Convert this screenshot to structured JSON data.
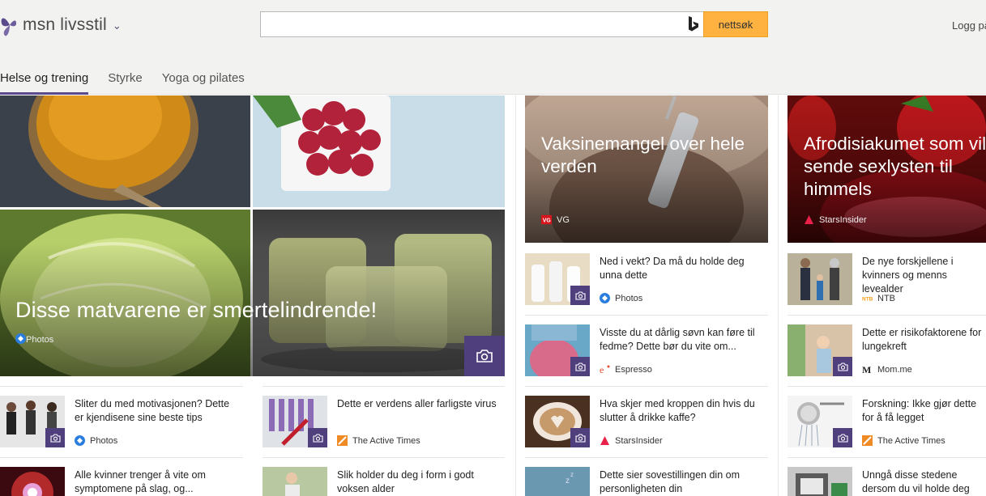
{
  "header": {
    "brand": "msn livsstil",
    "search_placeholder": "",
    "search_button": "nettsøk",
    "login": "Logg på"
  },
  "tabs": [
    {
      "label": "Helse og trening",
      "active": true
    },
    {
      "label": "Styrke",
      "active": false
    },
    {
      "label": "Yoga og pilates",
      "active": false
    }
  ],
  "hero": {
    "title": "Disse matvarene er smertelindrende!",
    "source": "Photos"
  },
  "big_cards": [
    {
      "title": "Vaksinemangel over hele verden",
      "source": "VG"
    },
    {
      "title": "Afrodisiakumet som vil sende sexlysten til himmels",
      "source": "StarsInsider"
    }
  ],
  "col1_items": [
    {
      "title": "Sliter du med motivasjonen? Dette er kjendisene sine beste tips",
      "source": "Photos"
    },
    {
      "title": "Alle kvinner trenger å vite om symptomene på slag, og...",
      "source": ""
    }
  ],
  "col2_items": [
    {
      "title": "Dette er verdens aller farligste virus",
      "source": "The Active Times"
    },
    {
      "title": "Slik holder du deg i form i godt voksen alder",
      "source": ""
    }
  ],
  "col3_items": [
    {
      "title": "Ned i vekt? Da må du holde deg unna dette",
      "source": "Photos"
    },
    {
      "title": "Visste du at dårlig søvn kan føre til fedme? Dette bør du vite om...",
      "source": "Espresso"
    },
    {
      "title": "Hva skjer med kroppen din hvis du slutter å drikke kaffe?",
      "source": "StarsInsider"
    },
    {
      "title": "Dette sier sovestillingen din om personligheten din",
      "source": ""
    }
  ],
  "col4_items": [
    {
      "title": "De nye forskjellene i kvinners og menns levealder",
      "source": "NTB"
    },
    {
      "title": "Dette er risikofaktorene for lungekreft",
      "source": "Mom.me"
    },
    {
      "title": "Forskning: Ikke gjør dette for å få legget",
      "source": "The Active Times"
    },
    {
      "title": "Unngå disse stedene dersom du vil holde deg frisk",
      "source": ""
    }
  ],
  "colors": {
    "accent_purple": "#5b4a8c",
    "camera_badge": "#4f3f7d",
    "search_button": "#ffb23f",
    "header_bg": "#f2f2f1"
  }
}
